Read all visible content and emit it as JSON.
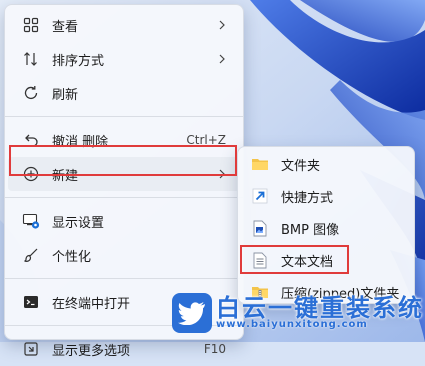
{
  "main_menu": {
    "items": [
      {
        "label": "查看",
        "icon": "grid-view-icon"
      },
      {
        "label": "排序方式",
        "icon": "sort-icon"
      },
      {
        "label": "刷新",
        "icon": "refresh-icon"
      },
      {
        "label": "撤消 删除",
        "shortcut": "Ctrl+Z",
        "icon": "undo-icon"
      },
      {
        "label": "新建",
        "icon": "new-plus-icon"
      },
      {
        "label": "显示设置",
        "icon": "display-settings-icon"
      },
      {
        "label": "个性化",
        "icon": "brush-icon"
      },
      {
        "label": "在终端中打开",
        "icon": "terminal-icon"
      },
      {
        "label": "显示更多选项",
        "shortcut": "F10",
        "icon": "more-options-icon"
      }
    ]
  },
  "sub_menu": {
    "items": [
      {
        "label": "文件夹",
        "icon": "folder-icon"
      },
      {
        "label": "快捷方式",
        "icon": "shortcut-icon"
      },
      {
        "label": "BMP 图像",
        "icon": "bmp-image-icon"
      },
      {
        "label": "文本文档",
        "icon": "text-document-icon"
      },
      {
        "label": "压缩(zipped)文件夹",
        "icon": "zip-folder-icon"
      }
    ]
  },
  "watermark": {
    "name": "白云一键重装系统",
    "url": "www.baiyunxitong.com"
  },
  "colors": {
    "highlight": "#e03b3b",
    "accent": "#2b6fd6"
  }
}
